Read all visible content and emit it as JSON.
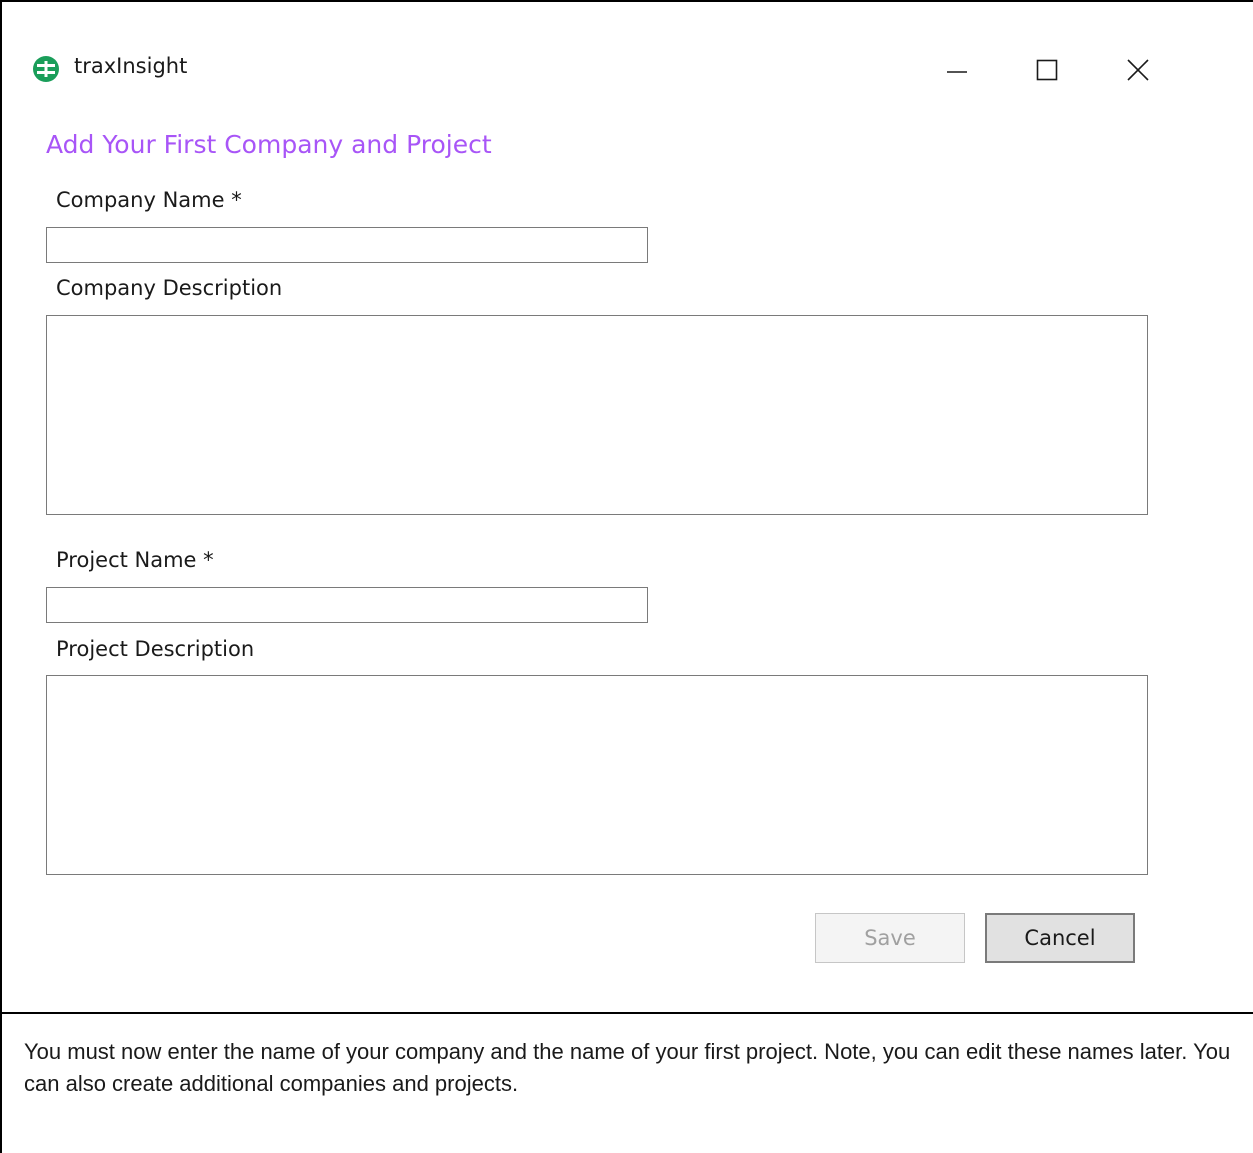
{
  "window": {
    "app_title": "traxInsight",
    "app_icon": "traxinsight-logo-icon",
    "controls": {
      "minimize_icon": "minimize-icon",
      "maximize_icon": "maximize-icon",
      "close_icon": "close-icon"
    }
  },
  "form": {
    "title": "Add Your First Company and Project",
    "title_color": "#a855f7",
    "company_name": {
      "label": "Company Name *",
      "value": ""
    },
    "company_description": {
      "label": "Company Description",
      "value": ""
    },
    "project_name": {
      "label": "Project Name *",
      "value": ""
    },
    "project_description": {
      "label": "Project Description",
      "value": ""
    },
    "buttons": {
      "save_label": "Save",
      "save_enabled": false,
      "cancel_label": "Cancel"
    }
  },
  "instruction_text": "You must now enter the name of your company and the name of your first project. Note, you can edit these names later. You can also create additional companies and projects."
}
